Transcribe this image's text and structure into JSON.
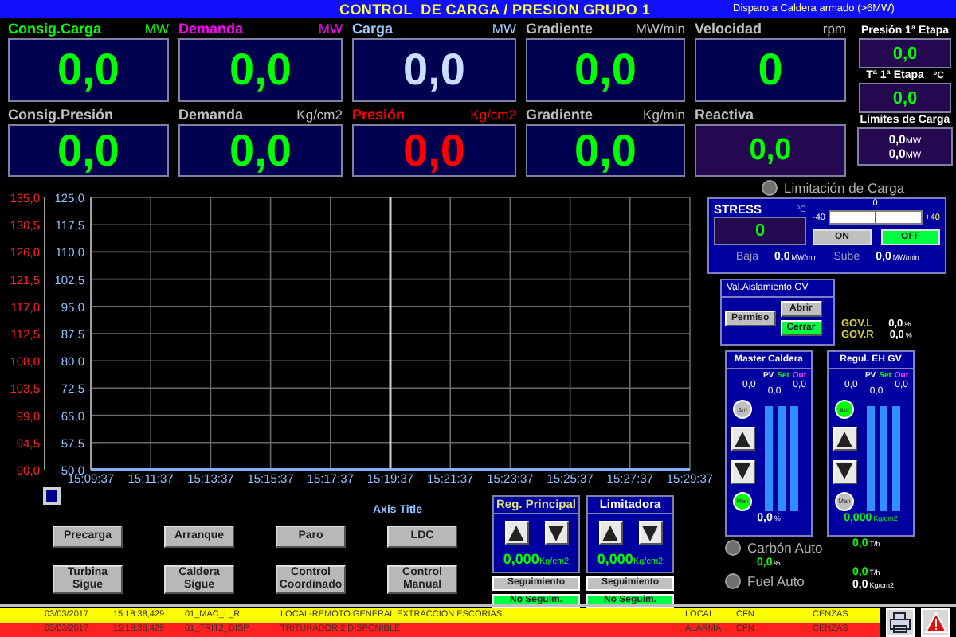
{
  "title_bar": {
    "title": "CONTROL  DE CARGA / PRESION GRUPO 1",
    "status": "Disparo a Caldera armado (>6MW)"
  },
  "tiles": [
    {
      "kind": "large",
      "label": "Consig.Carga",
      "unit": "MW",
      "color": "#00ff00",
      "reading": {
        "value": "0,0",
        "color": "#00ff00"
      }
    },
    {
      "kind": "large",
      "label": "Demanda",
      "unit": "MW",
      "color": "#ff00ff",
      "reading": {
        "value": "0,0",
        "color": "#00ff00"
      }
    },
    {
      "kind": "large",
      "label": "Carga",
      "unit": "MW",
      "color": "#a0c8ff",
      "reading": {
        "value": "0,0",
        "color": "#c8ddff"
      }
    },
    {
      "kind": "large",
      "label": "Gradiente",
      "unit": "MW/min",
      "color": "#c0c0c0",
      "reading": {
        "value": "0,0",
        "color": "#00ff00"
      }
    },
    {
      "kind": "large",
      "label": "Velocidad",
      "unit": "rpm",
      "color": "#c0c0c0",
      "reading": {
        "value": "0",
        "color": "#00ff00"
      }
    },
    {
      "kind": "large",
      "label": "Consig.Presión",
      "color": "#c0c0c0",
      "reading": {
        "value": "0,0",
        "color": "#00ff00"
      }
    },
    {
      "kind": "large",
      "label": "Demanda",
      "unit": "Kg/cm2",
      "color": "#c0c0c0",
      "reading": {
        "value": "0,0",
        "color": "#00ff00"
      }
    },
    {
      "kind": "large",
      "label": "Presión",
      "unit": "Kg/cm2",
      "color": "#ff0000",
      "reading": {
        "value": "0,0",
        "color": "#ff0000"
      }
    },
    {
      "kind": "large",
      "label": "Gradiente",
      "unit": "Kg/min",
      "color": "#c0c0c0",
      "reading": {
        "value": "0,0",
        "color": "#00ff00"
      }
    },
    {
      "kind": "compact",
      "label": "Reactiva",
      "color": "#c0c0c0",
      "reading": {
        "value": "0,0",
        "color": "#00ff00"
      }
    }
  ],
  "side_readings": [
    {
      "label": "Presión 1ª Etapa",
      "value": "0,0"
    },
    {
      "label": "Tª 1ª Etapa",
      "unit": "ºC",
      "value": "0,0"
    }
  ],
  "load_limits": {
    "label": "Límites de Carga",
    "values": [
      {
        "value": "0,0",
        "unit": "MW"
      },
      {
        "value": "0,0",
        "unit": "MW"
      }
    ]
  },
  "chart": {
    "left_axis_labels": [
      "135,0",
      "130,5",
      "126,0",
      "121,5",
      "117,0",
      "112,5",
      "108,0",
      "103,5",
      "99,0",
      "94,5",
      "90,0"
    ],
    "legend_title": "Axis Title",
    "chart_data": {
      "type": "line",
      "x": [
        "15:09:37",
        "15:11:37",
        "15:13:37",
        "15:15:37",
        "15:17:37",
        "15:19:37",
        "15:21:37",
        "15:23:37",
        "15:25:37",
        "15:27:37",
        "15:29:37"
      ],
      "series": [
        {
          "color": "#80b0ff",
          "values": [
            50,
            50,
            50,
            50,
            50,
            50,
            50,
            50,
            50,
            50,
            50
          ]
        }
      ],
      "ylim": [
        50,
        125
      ],
      "yticks": [
        {
          "value": 125,
          "label": "125,0"
        },
        {
          "value": 117.5,
          "label": "117,5"
        },
        {
          "value": 110,
          "label": "110,0"
        },
        {
          "value": 102.5,
          "label": "102,5"
        },
        {
          "value": 95,
          "label": "95,0"
        },
        {
          "value": 87.5,
          "label": "87,5"
        },
        {
          "value": 80,
          "label": "80,0"
        },
        {
          "value": 72.5,
          "label": "72,5"
        },
        {
          "value": 65,
          "label": "65,0"
        },
        {
          "value": 57.5,
          "label": "57,5"
        },
        {
          "value": 50,
          "label": "50,0"
        }
      ],
      "grid": true,
      "ref_lines": [
        {
          "axis": "x",
          "value": "15:19:37",
          "color": "#d0d0d0"
        }
      ]
    }
  },
  "command_buttons": [
    {
      "label": "Precarga"
    },
    {
      "label": "Arranque"
    },
    {
      "label": "Paro"
    },
    {
      "label": "LDC"
    },
    {
      "label": "Turbina Sigue"
    },
    {
      "label": "Caldera Sigue"
    },
    {
      "label": "Control Coordinado"
    },
    {
      "label": "Control Manual"
    }
  ],
  "regulators": [
    {
      "title": "Reg. Principal",
      "color": "#e0e080",
      "value": "0,000",
      "unit": "Kg/cm2",
      "tracking": "Seguimiento",
      "tracking_on": false,
      "status": "No Seguim.",
      "status_on": true
    },
    {
      "title": "Limitadora",
      "color": "#ffffff",
      "value": "0,000",
      "unit": "Kg/cm2",
      "tracking": "Seguimiento",
      "tracking_on": false,
      "status": "No Seguim.",
      "status_on": true
    }
  ],
  "load_limitation": {
    "label": "Limitación de Carga",
    "on": false
  },
  "stress": {
    "title": "STRESS",
    "unit": "ºC",
    "value": "0",
    "scale_min": "-40",
    "scale_mid": "0",
    "scale_max": "+40",
    "level": 0.5,
    "buttons": [
      {
        "label": "ON",
        "active": false
      },
      {
        "label": "OFF",
        "active": true
      }
    ],
    "rates": [
      {
        "label": "Baja",
        "value": "0,0",
        "unit": "MW/min"
      },
      {
        "label": "Sube",
        "value": "0,0",
        "unit": "MW/min"
      }
    ]
  },
  "isolation_valve": {
    "title": "Val.Aislamiento GV",
    "buttons": [
      {
        "label": "Permiso",
        "active": false
      },
      {
        "label": "Abrir",
        "active": false
      },
      {
        "label": "Cerrar",
        "active": true
      }
    ],
    "readings": [
      {
        "label": "GOV.L",
        "value": "0,0",
        "unit": "%"
      },
      {
        "label": "GOV.R",
        "value": "0,0",
        "unit": "%"
      }
    ]
  },
  "controllers": [
    {
      "title": "Master Caldera",
      "pv": "PV",
      "set": "Set",
      "out": "Out",
      "pv_value": "0,0",
      "set_value": "0,0",
      "out_value": "0,0",
      "auto_label": "Aut",
      "auto": false,
      "manual_label": "Man",
      "manual": true,
      "value": "0,0",
      "unit": "%"
    },
    {
      "title": "Regul. EH GV",
      "pv": "PV",
      "set": "Set",
      "out": "Out",
      "pv_value": "0,0",
      "set_value": "0,0",
      "out_value": "0,0",
      "auto_label": "Aut",
      "auto": true,
      "manual_label": "Man",
      "manual": false,
      "value": "0,000",
      "unit": "Kg/cm2"
    }
  ],
  "fuel": {
    "coal": {
      "label": "Carbón Auto",
      "on": false
    },
    "coal_share": {
      "value": "0,0",
      "unit": "%"
    },
    "oil": {
      "label": "Fuel Auto",
      "on": false
    },
    "flows": [
      {
        "value": "0,0",
        "unit": "T/h"
      },
      {
        "value": "0,0",
        "unit": "T/h"
      },
      {
        "value": "0,0",
        "unit": "Kg/cm2"
      }
    ]
  },
  "alarms": [
    {
      "color": "#ffff00",
      "date": "03/03/2017",
      "time": "15:18:38,429",
      "tag": "01_MAC_L_R",
      "text": "LOCAL-REMOTO GENERAL EXTRACCION ESCORIAS",
      "state": "LOCAL",
      "unit": "CFN",
      "area": "CENZAS"
    },
    {
      "color": "#ff2020",
      "date": "03/03/2017",
      "time": "15:18:38,429",
      "tag": "01_TRIT2_DISP",
      "text": "TRITURADOR 2 DISPONIBLE",
      "state": "ALARMA",
      "unit": "CFN",
      "area": "CENZAS"
    }
  ]
}
